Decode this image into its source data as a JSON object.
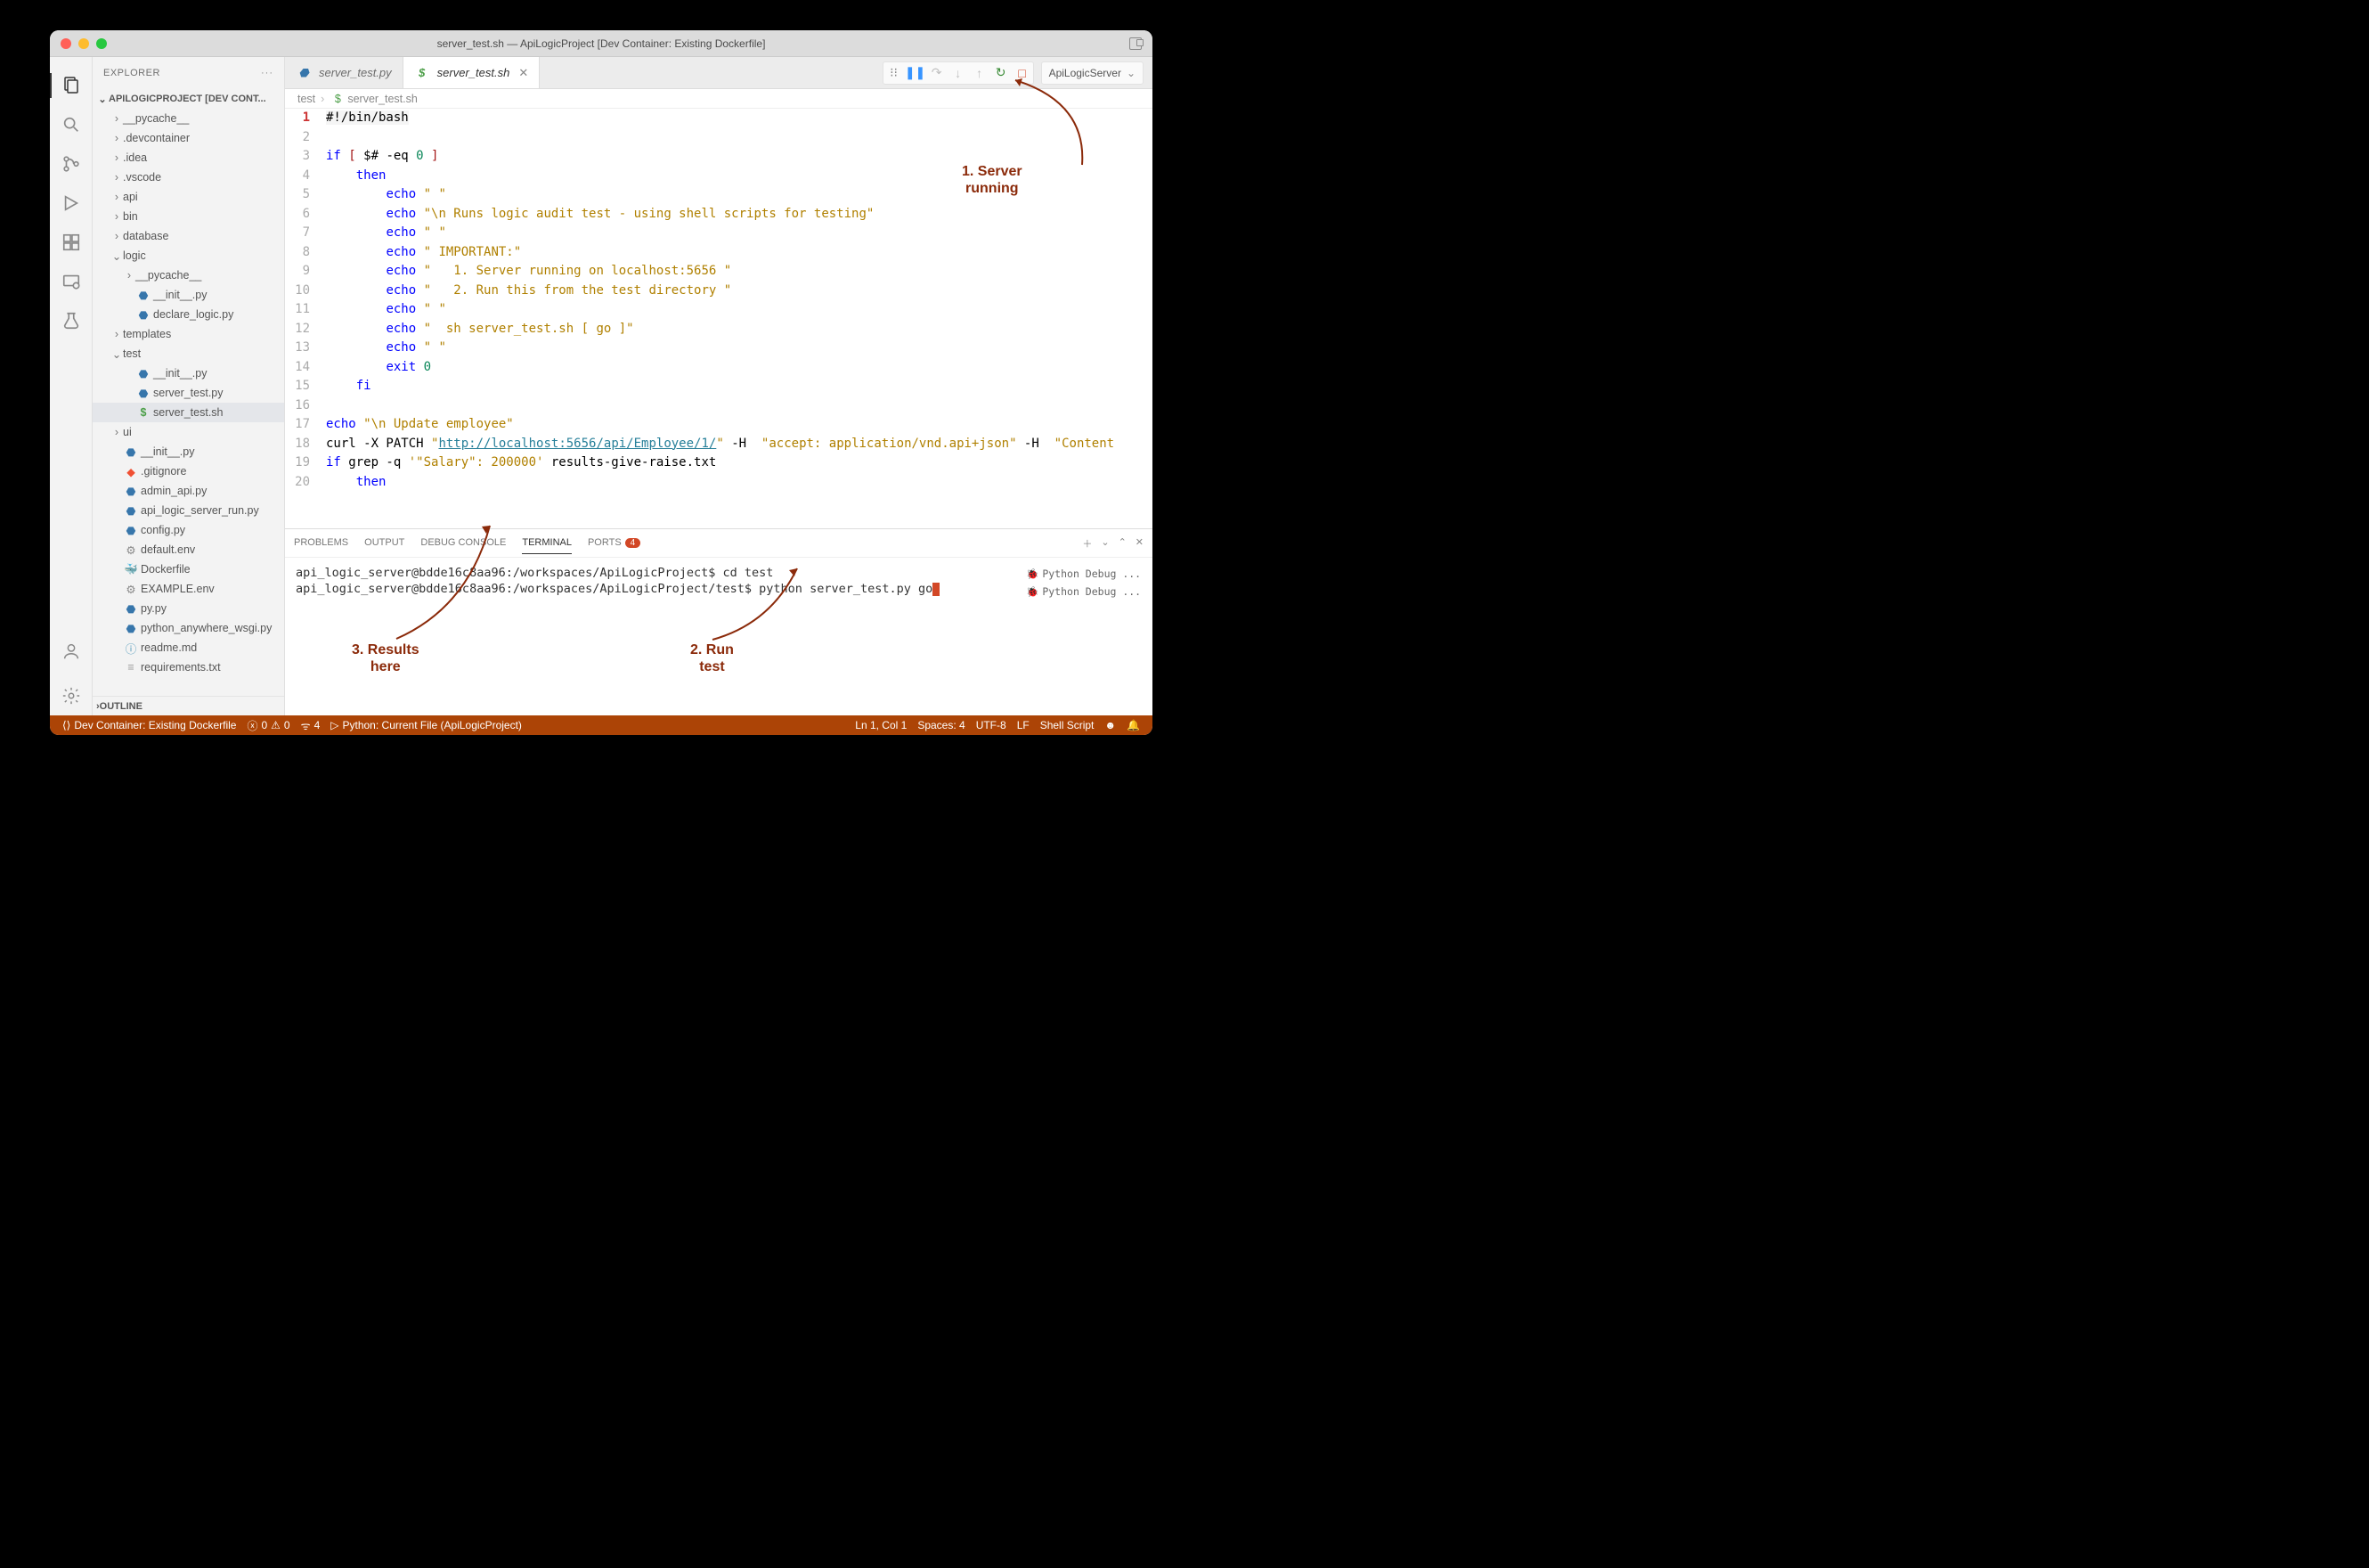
{
  "window": {
    "title": "server_test.sh — ApiLogicProject [Dev Container: Existing Dockerfile]"
  },
  "sidebar": {
    "header": "EXPLORER",
    "section": "APILOGICPROJECT [DEV CONT...",
    "outline": "OUTLINE",
    "tree": [
      {
        "d": 1,
        "t": "dir",
        "c": false,
        "label": "__pycache__"
      },
      {
        "d": 1,
        "t": "dir",
        "c": false,
        "label": ".devcontainer"
      },
      {
        "d": 1,
        "t": "dir",
        "c": false,
        "label": ".idea"
      },
      {
        "d": 1,
        "t": "dir",
        "c": false,
        "label": ".vscode"
      },
      {
        "d": 1,
        "t": "dir",
        "c": false,
        "label": "api"
      },
      {
        "d": 1,
        "t": "dir",
        "c": false,
        "label": "bin"
      },
      {
        "d": 1,
        "t": "dir",
        "c": false,
        "label": "database"
      },
      {
        "d": 1,
        "t": "dir",
        "c": true,
        "label": "logic"
      },
      {
        "d": 2,
        "t": "dir",
        "c": false,
        "label": "__pycache__"
      },
      {
        "d": 2,
        "t": "py",
        "label": "__init__.py"
      },
      {
        "d": 2,
        "t": "py",
        "label": "declare_logic.py"
      },
      {
        "d": 1,
        "t": "dir",
        "c": false,
        "label": "templates"
      },
      {
        "d": 1,
        "t": "dir",
        "c": true,
        "label": "test"
      },
      {
        "d": 2,
        "t": "py",
        "label": "__init__.py"
      },
      {
        "d": 2,
        "t": "py",
        "label": "server_test.py"
      },
      {
        "d": 2,
        "t": "sh",
        "label": "server_test.sh",
        "sel": true
      },
      {
        "d": 1,
        "t": "dir",
        "c": false,
        "label": "ui"
      },
      {
        "d": 1,
        "t": "py",
        "label": "__init__.py"
      },
      {
        "d": 1,
        "t": "git",
        "label": ".gitignore"
      },
      {
        "d": 1,
        "t": "py",
        "label": "admin_api.py"
      },
      {
        "d": 1,
        "t": "py",
        "label": "api_logic_server_run.py"
      },
      {
        "d": 1,
        "t": "py",
        "label": "config.py"
      },
      {
        "d": 1,
        "t": "env",
        "label": "default.env"
      },
      {
        "d": 1,
        "t": "dk",
        "label": "Dockerfile"
      },
      {
        "d": 1,
        "t": "env",
        "label": "EXAMPLE.env"
      },
      {
        "d": 1,
        "t": "py",
        "label": "py.py"
      },
      {
        "d": 1,
        "t": "py",
        "label": "python_anywhere_wsgi.py"
      },
      {
        "d": 1,
        "t": "md",
        "label": "readme.md"
      },
      {
        "d": 1,
        "t": "txt",
        "label": "requirements.txt"
      }
    ]
  },
  "tabs": [
    {
      "icon": "py",
      "label": "server_test.py",
      "active": false
    },
    {
      "icon": "sh",
      "label": "server_test.sh",
      "active": true
    }
  ],
  "debug_config": "ApiLogicServer",
  "breadcrumb": [
    "test",
    "server_test.sh"
  ],
  "editor": {
    "lines": [
      {
        "n": 1,
        "cur": true,
        "html": "<span class='hl-line'>#!/bin/bash</span>"
      },
      {
        "n": 2,
        "html": ""
      },
      {
        "n": 3,
        "html": "<span class='k-blue'>if</span> <span class='k-red'>[</span> $# -eq <span class='k-num'>0</span> <span class='k-red'>]</span>"
      },
      {
        "n": 4,
        "html": "    <span class='k-blue'>then</span>"
      },
      {
        "n": 5,
        "html": "        <span class='k-blue'>echo</span> <span class='k-str'>\" \"</span>"
      },
      {
        "n": 6,
        "html": "        <span class='k-blue'>echo</span> <span class='k-str'>\"\\n Runs logic audit test - using shell scripts for testing\"</span>"
      },
      {
        "n": 7,
        "html": "        <span class='k-blue'>echo</span> <span class='k-str'>\" \"</span>"
      },
      {
        "n": 8,
        "html": "        <span class='k-blue'>echo</span> <span class='k-str'>\" IMPORTANT:\"</span>"
      },
      {
        "n": 9,
        "html": "        <span class='k-blue'>echo</span> <span class='k-str'>\"   1. Server running on localhost:5656 \"</span>"
      },
      {
        "n": 10,
        "html": "        <span class='k-blue'>echo</span> <span class='k-str'>\"   2. Run this from the test directory \"</span>"
      },
      {
        "n": 11,
        "html": "        <span class='k-blue'>echo</span> <span class='k-str'>\" \"</span>"
      },
      {
        "n": 12,
        "html": "        <span class='k-blue'>echo</span> <span class='k-str'>\"  sh server_test.sh [ go ]\"</span>"
      },
      {
        "n": 13,
        "html": "        <span class='k-blue'>echo</span> <span class='k-str'>\" \"</span>"
      },
      {
        "n": 14,
        "html": "        <span class='k-blue'>exit</span> <span class='k-num'>0</span>"
      },
      {
        "n": 15,
        "html": "    <span class='k-blue'>fi</span>"
      },
      {
        "n": 16,
        "html": ""
      },
      {
        "n": 17,
        "html": "<span class='k-blue'>echo</span> <span class='k-str'>\"\\n Update employee\"</span>"
      },
      {
        "n": 18,
        "html": "curl -X PATCH <span class='k-str'>\"<span class='k-url'>http://localhost:5656/api/Employee/1/</span>\"</span> -H  <span class='k-str'>\"accept: application/vnd.api+json\"</span> -H  <span class='k-str'>\"Content</span>"
      },
      {
        "n": 19,
        "html": "<span class='k-blue'>if</span> grep -q <span class='k-str'>'\"Salary\": 200000'</span> results-give-raise.txt"
      },
      {
        "n": 20,
        "html": "    <span class='k-blue'>then</span>"
      }
    ]
  },
  "panel": {
    "tabs": [
      "PROBLEMS",
      "OUTPUT",
      "DEBUG CONSOLE",
      "TERMINAL",
      "PORTS"
    ],
    "active": 3,
    "ports_badge": "4",
    "terminal_lines": [
      "api_logic_server@bdde16c8aa96:/workspaces/ApiLogicProject$ cd test",
      "api_logic_server@bdde16c8aa96:/workspaces/ApiLogicProject/test$ python server_test.py go"
    ],
    "terminal_side": [
      "Python Debug ...",
      "Python Debug ..."
    ]
  },
  "statusbar": {
    "left": {
      "container": "Dev Container: Existing Dockerfile",
      "err": "0",
      "warn": "0",
      "ports": "4",
      "debug": "Python: Current File (ApiLogicProject)"
    },
    "right": {
      "pos": "Ln 1, Col 1",
      "spaces": "Spaces: 4",
      "enc": "UTF-8",
      "eol": "LF",
      "lang": "Shell Script"
    }
  },
  "annotations": {
    "a1": "1. Server\nrunning",
    "a2": "2. Run\ntest",
    "a3": "3. Results\nhere"
  }
}
